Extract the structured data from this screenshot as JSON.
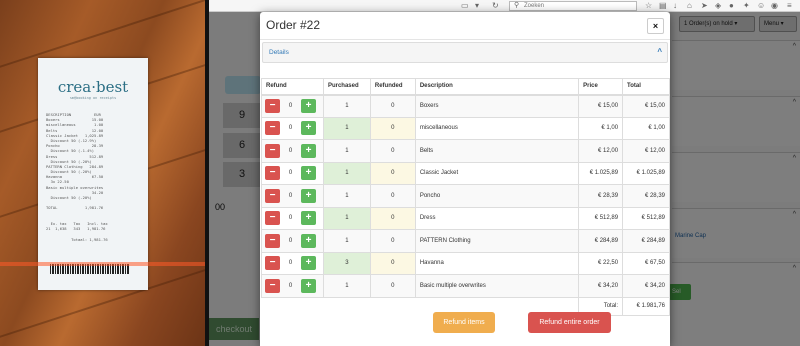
{
  "receipt": {
    "logo": "crea·best",
    "tagline": "sm@booking on receipts",
    "lines": [
      "DESCRIPTION          EUR",
      "Boxers              15.00",
      "miscellaneous        1.00",
      "Belts               12.00",
      "Classic Jacket   1,025.89",
      "  Discount 50 (-12.9%)",
      "Poncho              28.39",
      "  Discount 50 (-1.4%)",
      "Dress              512.89",
      "  Discount 50 (-20%)",
      "PATTERN Clothing   284.89",
      "  Discount 50 (-20%)",
      "Havanna             67.50",
      "  3x 22.50",
      "Basic multiple overwrites",
      "                    34.20",
      "  Discount 50 (-20%)",
      "",
      "TOTAL            1,981.76",
      "",
      "",
      "  Ex. tax   Tax   Incl. tax",
      "21  1,638   343   1,981.76",
      "",
      "           Totaal: 1,981.76"
    ]
  },
  "browser": {
    "search_placeholder": "Zoeken"
  },
  "background": {
    "keypad": [
      "9",
      "6",
      "3",
      "00"
    ],
    "checkout_label": "checkout",
    "onhold_label": "1 Order(s) on hold ▾",
    "menu_label": "Menu ▾",
    "product_label": "Marine Cap",
    "green_btn_label": "Sel"
  },
  "modal": {
    "title": "Order  #22",
    "close_label": "×",
    "details_label": "Details",
    "columns": {
      "refund": "Refund",
      "purchased": "Purchased",
      "refunded": "Refunded",
      "description": "Description",
      "price": "Price",
      "total": "Total"
    },
    "rows": [
      {
        "qty": "0",
        "purchased": "1",
        "refunded": "0",
        "description": "Boxers",
        "price": "€ 15,00",
        "total": "€ 15,00"
      },
      {
        "qty": "0",
        "purchased": "1",
        "refunded": "0",
        "description": "miscellaneous",
        "price": "€ 1,00",
        "total": "€ 1,00"
      },
      {
        "qty": "0",
        "purchased": "1",
        "refunded": "0",
        "description": "Belts",
        "price": "€ 12,00",
        "total": "€ 12,00"
      },
      {
        "qty": "0",
        "purchased": "1",
        "refunded": "0",
        "description": "Classic Jacket",
        "price": "€ 1.025,89",
        "total": "€ 1.025,89"
      },
      {
        "qty": "0",
        "purchased": "1",
        "refunded": "0",
        "description": "Poncho",
        "price": "€ 28,39",
        "total": "€ 28,39"
      },
      {
        "qty": "0",
        "purchased": "1",
        "refunded": "0",
        "description": "Dress",
        "price": "€ 512,89",
        "total": "€ 512,89"
      },
      {
        "qty": "0",
        "purchased": "1",
        "refunded": "0",
        "description": "PATTERN Clothing",
        "price": "€ 284,89",
        "total": "€ 284,89"
      },
      {
        "qty": "0",
        "purchased": "3",
        "refunded": "0",
        "description": "Havanna",
        "price": "€ 22,50",
        "total": "€ 67,50"
      },
      {
        "qty": "0",
        "purchased": "1",
        "refunded": "0",
        "description": "Basic multiple overwrites",
        "price": "€ 34,20",
        "total": "€ 34,20"
      }
    ],
    "total_label": "Total:",
    "total_value": "€ 1.981,76",
    "refund_items_label": "Refund items",
    "refund_order_label": "Refund entire order",
    "colors": {
      "minus": "#d9534f",
      "plus": "#5cb85c",
      "purchased_bg": "#dff0d8",
      "refunded_bg": "#fcf8e3",
      "refund_items": "#f0ad4e",
      "refund_order": "#d9534f"
    }
  }
}
